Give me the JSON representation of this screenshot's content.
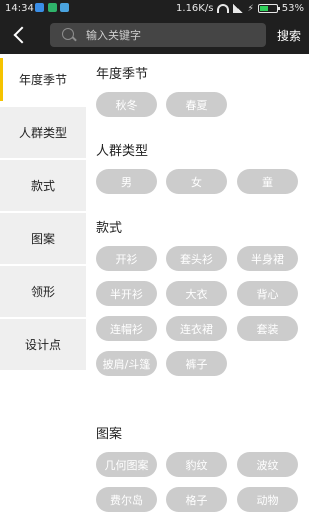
{
  "status_bar": {
    "time": "14:34",
    "network_speed": "1.16K/s",
    "battery": "53%",
    "battery_level": 0.53
  },
  "search": {
    "placeholder": "输入关键字",
    "button_label": "搜索"
  },
  "sidebar": {
    "items": [
      {
        "label": "年度季节",
        "active": true
      },
      {
        "label": "人群类型",
        "active": false
      },
      {
        "label": "款式",
        "active": false
      },
      {
        "label": "图案",
        "active": false
      },
      {
        "label": "领形",
        "active": false
      },
      {
        "label": "设计点",
        "active": false
      }
    ]
  },
  "sections": [
    {
      "title": "年度季节",
      "tags": [
        "秋冬",
        "春夏"
      ]
    },
    {
      "title": "人群类型",
      "tags": [
        "男",
        "女",
        "童"
      ]
    },
    {
      "title": "款式",
      "tags": [
        "开衫",
        "套头衫",
        "半身裙",
        "半开衫",
        "大衣",
        "背心",
        "连帽衫",
        "连衣裙",
        "套装",
        "披肩/斗篷",
        "裤子"
      ]
    },
    {
      "title": "图案",
      "tags": [
        "几何图案",
        "豹纹",
        "波纹",
        "费尔岛",
        "格子",
        "动物"
      ]
    }
  ]
}
